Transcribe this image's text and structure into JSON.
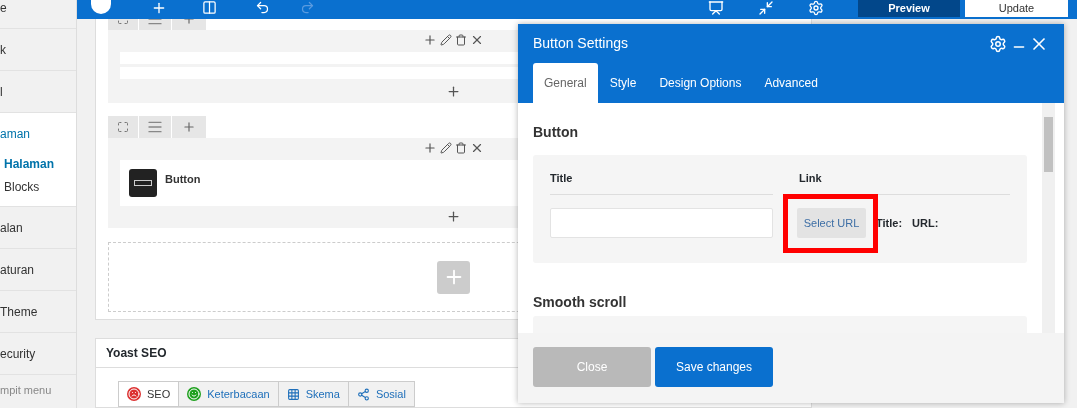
{
  "sidebar": {
    "items": [
      {
        "label": "e",
        "selected": false
      },
      {
        "label": "k",
        "selected": false
      },
      {
        "label": "l",
        "selected": false
      },
      {
        "label": "aman",
        "selected": true,
        "children": [
          {
            "label": "Halaman",
            "selected": true
          },
          {
            "label": "Blocks",
            "selected": false
          }
        ]
      },
      {
        "label": "alan",
        "selected": false
      },
      {
        "label": "aturan",
        "selected": false
      },
      {
        "label": "Theme",
        "selected": false
      },
      {
        "label": "ecurity",
        "selected": false
      }
    ],
    "collapse": "mpit menu"
  },
  "toolbar": {
    "preview": "Preview",
    "update": "Update"
  },
  "editor": {
    "rows": [
      {
        "elements": []
      },
      {
        "elements": [
          {
            "label": "Button"
          }
        ]
      }
    ]
  },
  "yoast": {
    "title": "Yoast SEO",
    "tabs": [
      {
        "label": "SEO",
        "selected": true,
        "kind": "seo",
        "color": "#dc3232"
      },
      {
        "label": "Keterbacaan",
        "selected": false,
        "kind": "readability",
        "color": "#1ea01e"
      },
      {
        "label": "Skema",
        "selected": false,
        "kind": "schema"
      },
      {
        "label": "Sosial",
        "selected": false,
        "kind": "social"
      }
    ]
  },
  "modal": {
    "title": "Button Settings",
    "tabs": [
      {
        "label": "General",
        "selected": true
      },
      {
        "label": "Style",
        "selected": false
      },
      {
        "label": "Design Options",
        "selected": false
      },
      {
        "label": "Advanced",
        "selected": false
      }
    ],
    "section": "Button",
    "fields": {
      "title_label": "Title",
      "link_label": "Link",
      "select_url": "Select URL",
      "link_title": "Title:",
      "link_url": "URL:"
    },
    "next_section": "Smooth scroll",
    "buttons": {
      "close": "Close",
      "save": "Save changes"
    }
  }
}
